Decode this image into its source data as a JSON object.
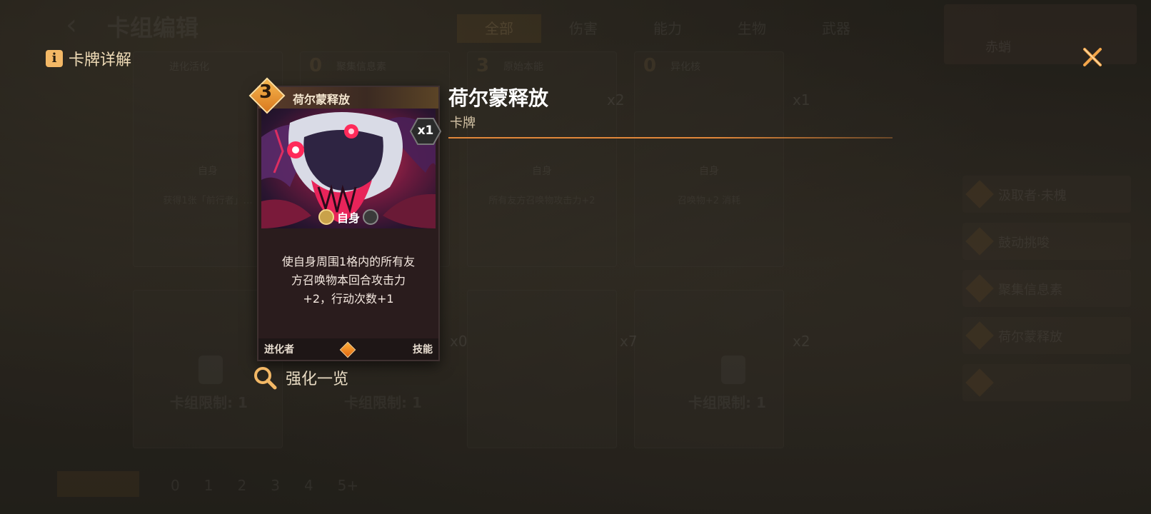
{
  "background": {
    "page_title": "卡组编辑",
    "tabs": [
      {
        "label": "全部",
        "active": true
      },
      {
        "label": "伤害",
        "active": false
      },
      {
        "label": "能力",
        "active": false
      },
      {
        "label": "生物",
        "active": false
      },
      {
        "label": "武器",
        "active": false
      }
    ],
    "profile_name": "赤蛸",
    "cards": [
      {
        "cost": "",
        "name": "进化活化",
        "tag": "自身",
        "desc": "获得1张「前行者」…",
        "count": ""
      },
      {
        "cost": "0",
        "name": "聚集信息素",
        "tag": "",
        "desc": "",
        "count": "x2"
      },
      {
        "cost": "3",
        "name": "原始本能",
        "tag": "自身",
        "desc": "所有友方召唤物攻击力+2",
        "count": "x2"
      },
      {
        "cost": "0",
        "name": "异化核",
        "tag": "自身",
        "desc": "召唤物+2 消耗",
        "count": "x1"
      }
    ],
    "bottom_counts": [
      "x0",
      "x7",
      "x2"
    ],
    "deck_limits": [
      "卡组限制: 1",
      "卡组限制: 1",
      "卡组限制: 1"
    ],
    "deck_list": [
      "汲取者·未槐",
      "鼓动挑唆",
      "聚集信息素",
      "荷尔蒙释放",
      ""
    ],
    "pager": [
      "0",
      "1",
      "2",
      "3",
      "4",
      "5+"
    ]
  },
  "modal": {
    "header_title": "卡牌详解",
    "card": {
      "cost": "3",
      "name": "荷尔蒙释放",
      "target_tag": "自身",
      "description_lines": [
        "使自身周围1格内的所有友",
        "方召唤物本回合攻击力",
        "+2，行动次数+1"
      ],
      "class_label": "进化者",
      "type_label": "技能",
      "quantity": "x1"
    },
    "heading": "荷尔蒙释放",
    "category": "卡牌",
    "upgrade_link": "强化一览"
  },
  "colors": {
    "accent": "#e1873a",
    "cost_orange": "#f6b74f",
    "header_text": "#f1ddb8"
  },
  "icons": [
    "info-icon",
    "close-icon",
    "search-icon",
    "lock-icon"
  ]
}
